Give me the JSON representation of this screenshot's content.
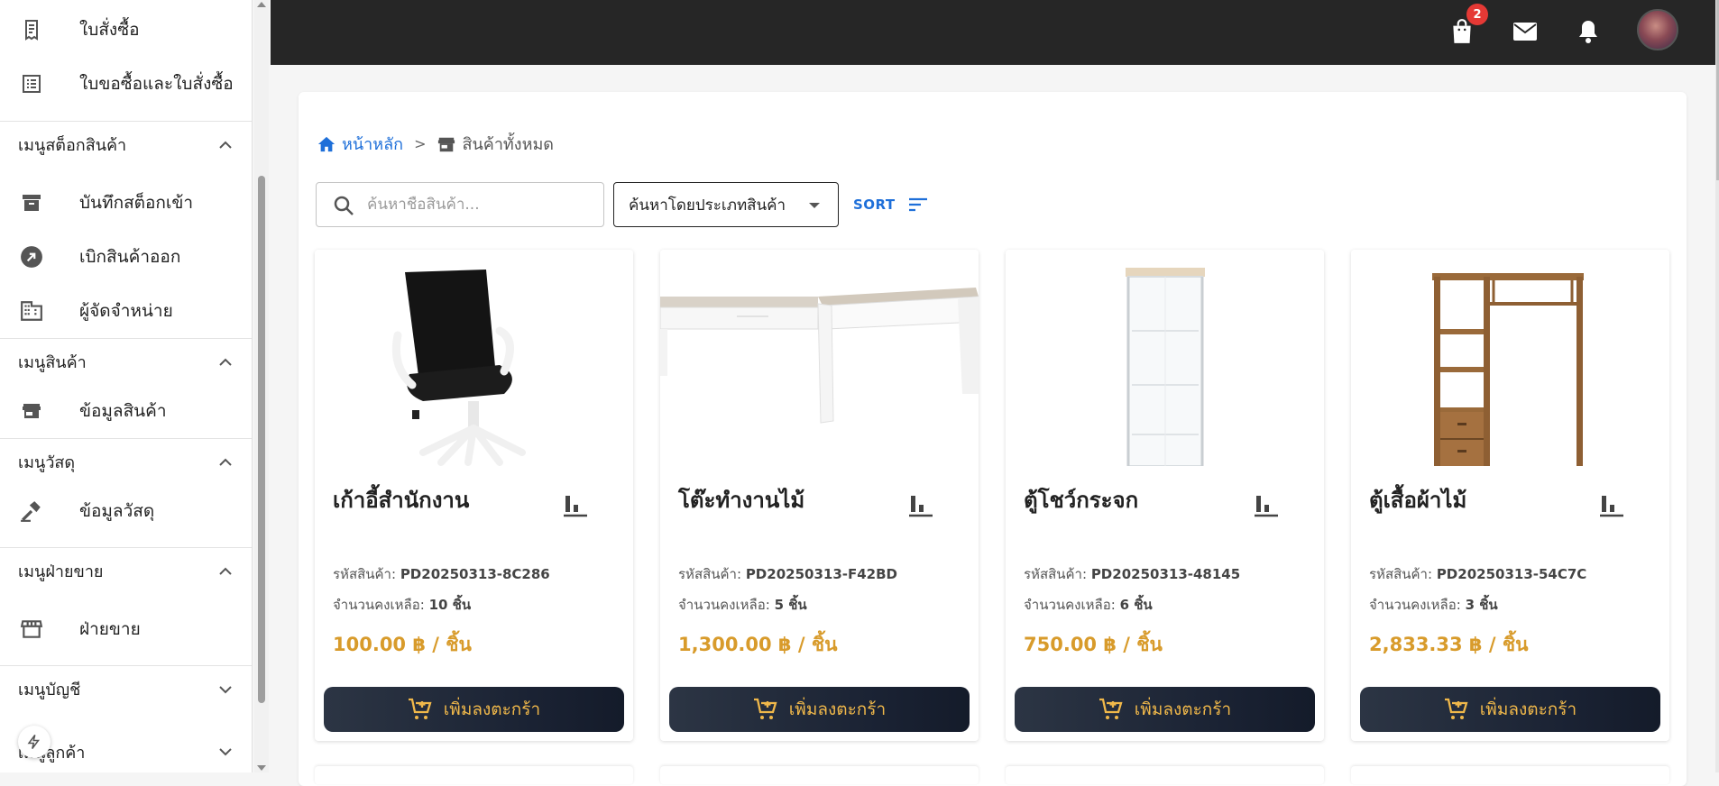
{
  "sidebar": {
    "items": [
      {
        "label": "ใบสั่งซื้อ",
        "icon": "receipt-icon"
      },
      {
        "label": "ใบขอซื้อและใบสั่งซื้อ",
        "icon": "list-icon"
      }
    ],
    "sections": [
      {
        "label": "เมนูสต็อกสินค้า",
        "expanded": true,
        "items": [
          {
            "label": "บันทึกสต็อกเข้า",
            "icon": "archive-icon"
          },
          {
            "label": "เบิกสินค้าออก",
            "icon": "arrow-out-icon"
          },
          {
            "label": "ผู้จัดจำหน่าย",
            "icon": "building-icon"
          }
        ]
      },
      {
        "label": "เมนูสินค้า",
        "expanded": true,
        "items": [
          {
            "label": "ข้อมูลสินค้า",
            "icon": "store-icon"
          }
        ]
      },
      {
        "label": "เมนูวัสดุ",
        "expanded": true,
        "items": [
          {
            "label": "ข้อมูลวัสดุ",
            "icon": "hammer-icon"
          }
        ]
      },
      {
        "label": "เมนูฝ่ายขาย",
        "expanded": true,
        "items": [
          {
            "label": "ฝ่ายขาย",
            "icon": "storefront-icon"
          }
        ]
      },
      {
        "label": "เมนูบัญชี",
        "expanded": false,
        "items": []
      },
      {
        "label": "เมนูลูกค้า",
        "expanded": false,
        "items": []
      }
    ]
  },
  "topbar": {
    "cart_badge": "2"
  },
  "breadcrumb": {
    "home": "หน้าหลัก",
    "separator": ">",
    "current": "สินค้าทั้งหมด"
  },
  "toolbar": {
    "search_placeholder": "ค้นหาชื่อสินค้า...",
    "filter_label": "ค้นหาโดยประเภทสินค้า",
    "sort_label": "SORT"
  },
  "products": [
    {
      "name": "เก้าอี้สำนักงาน",
      "code_label": "รหัสสินค้า:",
      "code": "PD20250313-8C286",
      "stock_label": "จำนวนคงเหลือ:",
      "stock": "10 ชิ้น",
      "price": "100.00 ฿ / ชิ้น",
      "add_label": "เพิ่มลงตะกร้า"
    },
    {
      "name": "โต๊ะทำงานไม้",
      "code_label": "รหัสสินค้า:",
      "code": "PD20250313-F42BD",
      "stock_label": "จำนวนคงเหลือ:",
      "stock": "5 ชิ้น",
      "price": "1,300.00 ฿ / ชิ้น",
      "add_label": "เพิ่มลงตะกร้า"
    },
    {
      "name": "ตู้โชว์กระจก",
      "code_label": "รหัสสินค้า:",
      "code": "PD20250313-48145",
      "stock_label": "จำนวนคงเหลือ:",
      "stock": "6 ชิ้น",
      "price": "750.00 ฿ / ชิ้น",
      "add_label": "เพิ่มลงตะกร้า"
    },
    {
      "name": "ตู้เสื้อผ้าไม้",
      "code_label": "รหัสสินค้า:",
      "code": "PD20250313-54C7C",
      "stock_label": "จำนวนคงเหลือ:",
      "stock": "3 ชิ้น",
      "price": "2,833.33 ฿ / ชิ้น",
      "add_label": "เพิ่มลงตะกร้า"
    }
  ],
  "colors": {
    "accent_blue": "#1e6fd9",
    "price_gold": "#d89b2b",
    "button_dark": "#1a2233",
    "topbar": "#262626",
    "badge_red": "#e53935"
  }
}
